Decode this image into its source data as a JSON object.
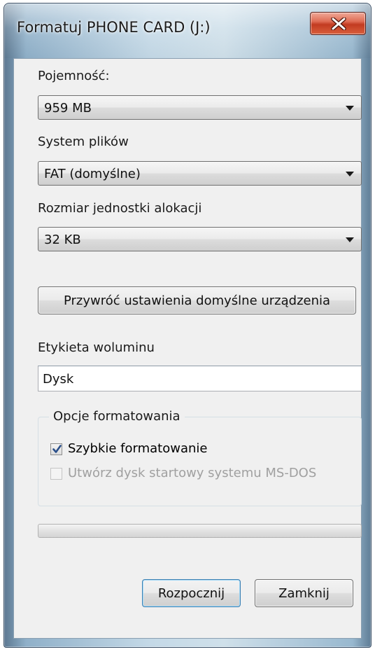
{
  "window": {
    "title": "Formatuj PHONE CARD (J:)"
  },
  "capacity": {
    "label": "Pojemność:",
    "value": "959 MB"
  },
  "file_system": {
    "label": "System plików",
    "value": "FAT (domyślne)"
  },
  "allocation": {
    "label": "Rozmiar jednostki alokacji",
    "value": "32 KB"
  },
  "restore_defaults_label": "Przywróć ustawienia domyślne urządzenia",
  "volume_label": {
    "label": "Etykieta woluminu",
    "value": "Dysk"
  },
  "format_options": {
    "title": "Opcje formatowania",
    "quick_format": {
      "label": "Szybkie formatowanie",
      "checked": true
    },
    "msdos_startup": {
      "label": "Utwórz dysk startowy systemu MS-DOS",
      "checked": false,
      "disabled": true
    }
  },
  "progress": {
    "fraction": 0
  },
  "buttons": {
    "start_label": "Rozpocznij",
    "close_label": "Zamknij"
  },
  "colors": {
    "close_button": "#c23b21",
    "checkmark": "#2a4f8a",
    "default_button_border": "#3c7fb1"
  },
  "icons": {
    "close": "close-x-icon",
    "dropdown": "chevron-down-icon",
    "check": "checkmark-icon"
  }
}
